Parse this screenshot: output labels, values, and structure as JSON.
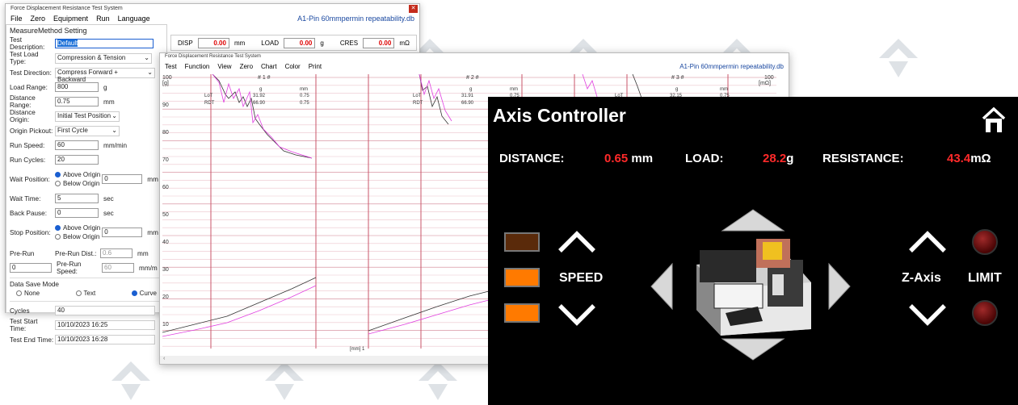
{
  "window_back": {
    "title": "Force Displacement Resistance Test System",
    "menu": [
      "File",
      "Zero",
      "Equipment",
      "Run",
      "Language"
    ],
    "db_name": "A1-Pin 60mmpermin repeatability.db",
    "section_title": "MeasureMethod Setting",
    "fields": {
      "test_description": {
        "label": "Test Description:",
        "value": "Default"
      },
      "test_load_type": {
        "label": "Test Load Type:",
        "value": "Compression & Tension"
      },
      "test_direction": {
        "label": "Test Direction:",
        "value": "Compress Forward + Backward"
      },
      "load_range": {
        "label": "Load Range:",
        "value": "800",
        "unit": "g"
      },
      "distance_range": {
        "label": "Distance Range:",
        "value": "0.75",
        "unit": "mm"
      },
      "distance_origin": {
        "label": "Distance Origin:",
        "value": "Initial Test Position"
      },
      "origin_pickout": {
        "label": "Origin Pickout:",
        "value": "First Cycle"
      },
      "run_speed": {
        "label": "Run Speed:",
        "value": "60",
        "unit": "mm/min"
      },
      "run_cycles": {
        "label": "Run Cycles:",
        "value": "20"
      },
      "wait_position": {
        "label": "Wait Position:",
        "opt1": "Above Origin",
        "opt2": "Below Origin",
        "value": "0",
        "unit": "mm"
      },
      "wait_time": {
        "label": "Wait Time:",
        "value": "5",
        "unit": "sec"
      },
      "back_pause": {
        "label": "Back Pause:",
        "value": "0",
        "unit": "sec"
      },
      "stop_position": {
        "label": "Stop Position:",
        "opt1": "Above Origin",
        "opt2": "Below Origin",
        "value": "0",
        "unit": "mm"
      },
      "pre_run": {
        "label": "Pre-Run",
        "value": "0"
      },
      "pre_run_dist": {
        "label": "Pre-Run Dist.:",
        "value": "0.6",
        "unit": "mm"
      },
      "pre_run_speed": {
        "label": "Pre-Run Speed:",
        "value": "60",
        "unit": "mm/m"
      },
      "data_save_mode": {
        "label": "Data Save Mode",
        "opt_none": "None",
        "opt_text": "Text",
        "opt_curve": "Curve"
      },
      "cycles": {
        "label": "Cycles",
        "value": "40"
      },
      "start_time": {
        "label": "Test Start Time:",
        "value": "10/10/2023 16:25"
      },
      "end_time": {
        "label": "Test End Time:",
        "value": "10/10/2023 16:28"
      }
    },
    "readout": {
      "disp_label": "DISP",
      "disp_value": "0.00",
      "disp_unit": "mm",
      "load_label": "LOAD",
      "load_value": "0.00",
      "load_unit": "g",
      "cres_label": "CRES",
      "cres_value": "0.00",
      "cres_unit": "mΩ"
    }
  },
  "window_front": {
    "title": "Force Displacement Resistance Test System",
    "menu": [
      "Test",
      "Function",
      "View",
      "Zero",
      "Chart",
      "Color",
      "Print"
    ],
    "db_name": "A1-Pin 60mmpermin repeatability.db",
    "chart_left_header": "# 1 #",
    "chart_mid_header": "# 2 #",
    "chart_right_header": "# 3 #",
    "y_top": "100",
    "y_unit": "[g]",
    "right_y_top": "100",
    "right_y_unit": "[mΩ]",
    "col_g": "g",
    "col_mm": "mm",
    "row1_label": "LoT",
    "row2_label": "RDT",
    "row1_g": "31.92",
    "row1_mm": "0.75",
    "row2_g": "66.90",
    "row2_mm": "0.75",
    "mid_row1_g": "31.91",
    "mid_row1_mm": "0.75",
    "mid_row2_g": "66.90",
    "right_row1_g": "32.15",
    "right_row1_mm": "0.75",
    "x_unit": "[mm] 1",
    "y_ticks": [
      "90",
      "80",
      "70",
      "60",
      "50",
      "40",
      "30",
      "20",
      "10"
    ]
  },
  "axis_controller": {
    "title": "Axis Controller",
    "distance_label": "DISTANCE:",
    "distance_value": "0.65",
    "distance_unit": "mm",
    "load_label": "LOAD:",
    "load_value": "28.2",
    "load_unit": "g",
    "resistance_label": "RESISTANCE:",
    "resistance_value": "43.4",
    "resistance_unit": "mΩ",
    "speed_label": "SPEED",
    "z_axis_label": "Z-Axis",
    "limit_label": "LIMIT",
    "colors": {
      "value": "#ff2a2a",
      "speed_low": "#5a2a0a",
      "speed_mid": "#ff7a00",
      "speed_high": "#ff7a00"
    }
  },
  "watermark_icon": "logo-watermark"
}
